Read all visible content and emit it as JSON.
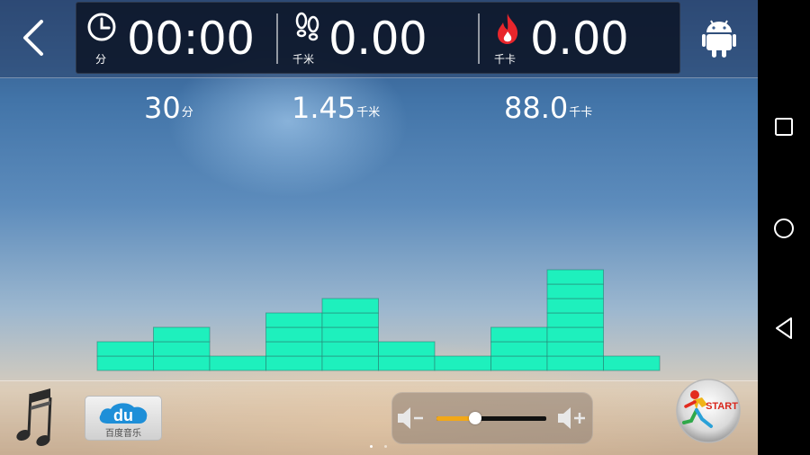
{
  "header": {
    "stats": [
      {
        "value": "00:00",
        "unit": "分",
        "icon": "clock-icon"
      },
      {
        "value": "0.00",
        "unit": "千米",
        "icon": "footprints-icon"
      },
      {
        "value": "0.00",
        "unit": "千卡",
        "icon": "flame-icon"
      }
    ]
  },
  "targets": [
    {
      "value": "30",
      "unit": "分"
    },
    {
      "value": "1.45",
      "unit": "千米"
    },
    {
      "value": "88.0",
      "unit": "千卡"
    }
  ],
  "equalizer": {
    "levels": [
      2,
      3,
      1,
      4,
      5,
      2,
      1,
      3,
      7,
      1
    ],
    "max_level": 7,
    "color": "#1ef0bd"
  },
  "bottom": {
    "du_logo_text": "du",
    "du_label": "百度音乐",
    "volume": {
      "level": 0.35
    },
    "start_label": "START"
  },
  "colors": {
    "flame": "#e8262c",
    "volume_fill": "#f2a818",
    "android": "#ffffff"
  }
}
